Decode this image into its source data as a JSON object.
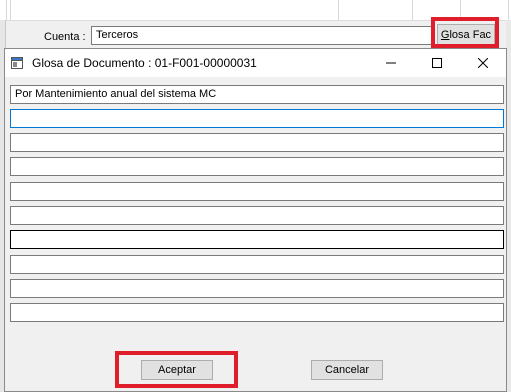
{
  "background_form": {
    "cuenta_label": "Cuenta :",
    "cuenta_value": "Terceros",
    "glosa_button": {
      "underlined": "G",
      "rest": "losa Fac"
    }
  },
  "dialog": {
    "title": "Glosa de Documento : 01-F001-00000031",
    "lines": [
      "Por Mantenimiento anual del sistema MC",
      "",
      "",
      "",
      "",
      "",
      "",
      "",
      "",
      "",
      ""
    ],
    "accept_label": "Aceptar",
    "cancel_label": "Cancelar"
  },
  "colors": {
    "highlight": "#e01e2b",
    "focus_border": "#0078d7"
  },
  "icons": [
    "app-window-icon",
    "minimize-icon",
    "maximize-icon",
    "close-icon"
  ]
}
